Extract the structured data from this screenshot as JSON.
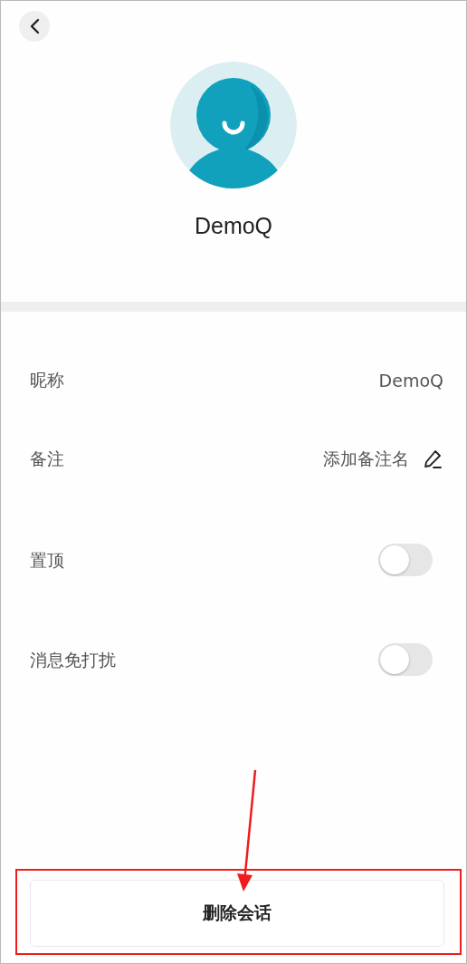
{
  "profile": {
    "name": "DemoQ"
  },
  "settings": [
    {
      "kind": "value",
      "label": "昵称",
      "value": "DemoQ"
    },
    {
      "kind": "edit",
      "label": "备注",
      "value": "添加备注名"
    },
    {
      "kind": "toggle",
      "label": "置顶",
      "on": false
    },
    {
      "kind": "toggle",
      "label": "消息免打扰",
      "on": false
    }
  ],
  "delete_button": {
    "label": "删除会话"
  }
}
